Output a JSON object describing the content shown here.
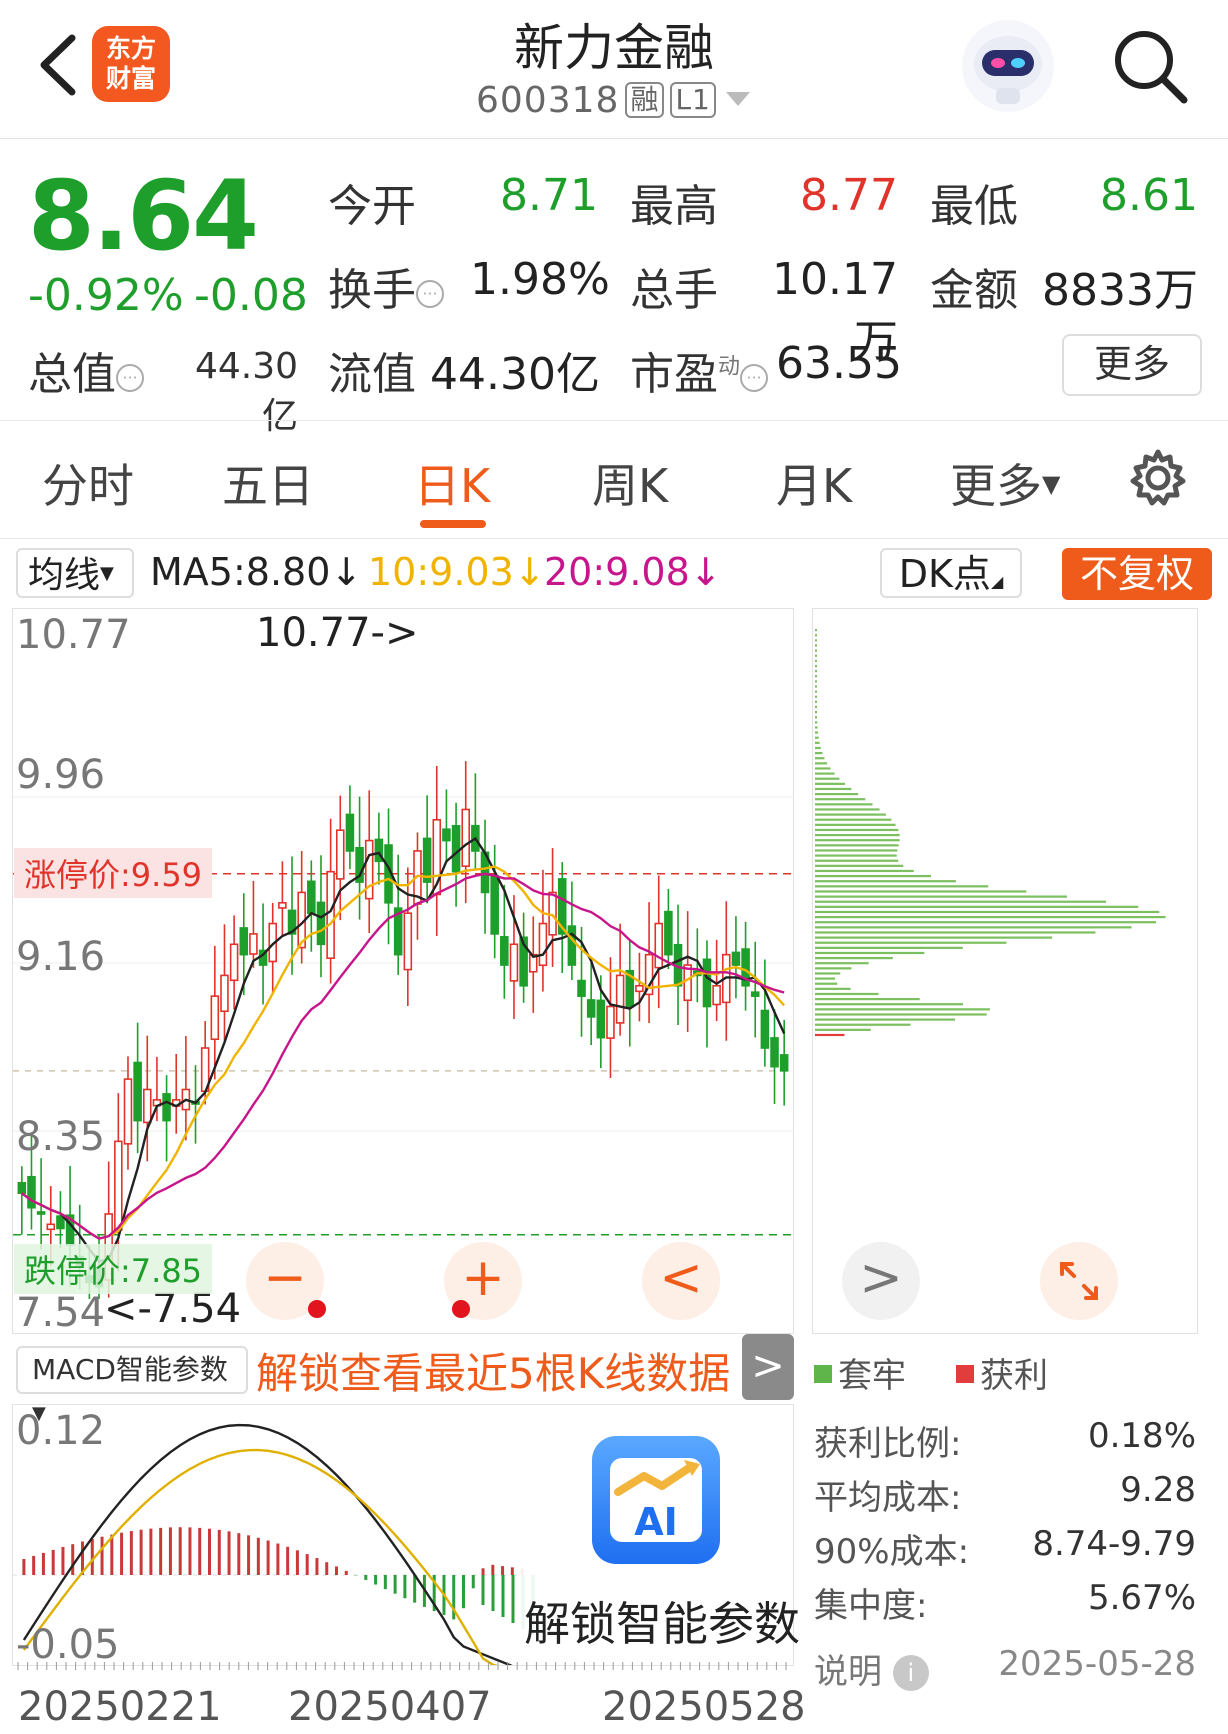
{
  "header": {
    "back_icon": "chevron-left-icon",
    "logo_line1": "东方",
    "logo_line2": "财富",
    "stock_name": "新力金融",
    "stock_code": "600318",
    "tag_margin": "融",
    "tag_level": "L1",
    "robot_icon": "robot-avatar-icon",
    "search_icon": "search-icon"
  },
  "quote": {
    "price": "8.64",
    "change_pct": "-0.92%",
    "change_abs": "-0.08",
    "fields": {
      "open_label": "今开",
      "open": "8.71",
      "high_label": "最高",
      "high": "8.77",
      "low_label": "最低",
      "low": "8.61",
      "turnover_label": "换手",
      "turnover": "1.98%",
      "volume_label": "总手",
      "volume": "10.17万",
      "amount_label": "金额",
      "amount": "8833万",
      "mcap_label": "总值",
      "mcap": "44.30亿",
      "float_label": "流值",
      "float_mcap": "44.30亿",
      "pe_label": "市盈",
      "pe_sup": "动",
      "pe": "63.55"
    },
    "more": "更多"
  },
  "tabs": {
    "items": [
      "分时",
      "五日",
      "日K",
      "周K",
      "月K",
      "更多"
    ],
    "active": "日K"
  },
  "indicator_bar": {
    "ma_select": "均线",
    "ma5": "MA5:8.80↓",
    "ma10": "10:9.03↓",
    "ma20": "20:9.08↓",
    "dk": "DK点",
    "fq": "不复权",
    "colors": {
      "ma5": "#222222",
      "ma10": "#f0b400",
      "ma20": "#c7158c"
    }
  },
  "kline": {
    "y_ticks": [
      "10.77",
      "9.96",
      "9.16",
      "8.35",
      "7.54"
    ],
    "max_label": "10.77->",
    "min_label": "<-7.54",
    "limit_up_label": "涨停价:9.59",
    "limit_down_label": "跌停价:7.85",
    "controls": {
      "zoom_out": "−",
      "zoom_in": "+",
      "prev": "<"
    }
  },
  "chip": {
    "next": ">",
    "expand_icon": "expand-icon",
    "legend_trapped": "套牢",
    "legend_profit": "获利",
    "stats": [
      {
        "label": "获利比例:",
        "value": "0.18%"
      },
      {
        "label": "平均成本:",
        "value": "9.28"
      },
      {
        "label": "90%成本:",
        "value": "8.74-9.79"
      },
      {
        "label": "集中度:",
        "value": "5.67%"
      }
    ],
    "note_label": "说明",
    "date": "2025-05-28"
  },
  "macd": {
    "select": "MACD智能参数",
    "unlock_text": "解锁查看最近5根K线数据",
    "y_top": "0.12",
    "y_bottom": "-0.05",
    "ai_badge": "AI",
    "ai_unlock": "解锁智能参数"
  },
  "x_axis": [
    "20250221",
    "20250407",
    "20250528"
  ],
  "colors": {
    "up": "#e0332a",
    "down": "#1e9e2a",
    "accent": "#ef5b1b"
  }
}
